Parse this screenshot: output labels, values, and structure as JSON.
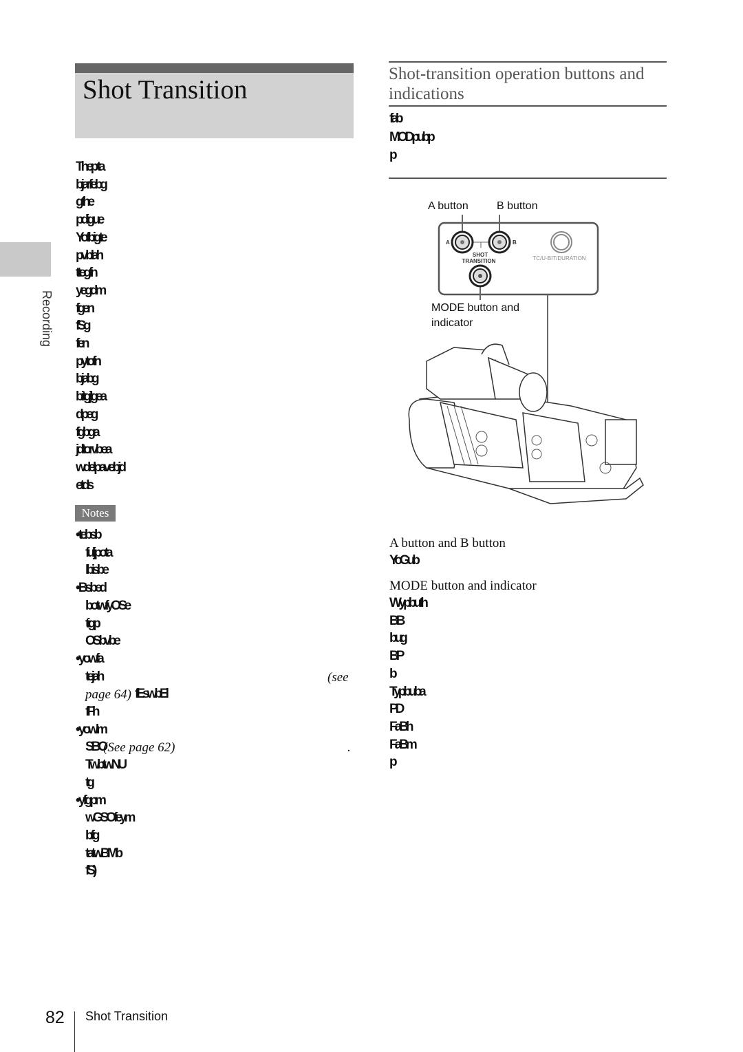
{
  "page": {
    "title": "Shot Transition",
    "section_tab": "Recording",
    "page_number": "82",
    "footer_title": "Shot Transition"
  },
  "left": {
    "intro_lines": [
      "Thep ta",
      "bjarfebg",
      "gthe",
      "pdigue",
      "Yofbigte",
      "pvblah",
      "ttegfn",
      "yegdm",
      "fgen",
      "fSg",
      "fen",
      "pytofn",
      "bjabg",
      "bitgjlgea",
      "dpeg",
      "fgbga",
      "jdtorvbea",
      "wdelpavebjd",
      "etds"
    ],
    "notes_label": "Notes",
    "notes_lines": [
      {
        "text": "• tebsb"
      },
      {
        "text": "fuljpota",
        "indent": true
      },
      {
        "text": "lbisbe",
        "indent": true
      },
      {
        "text": "• Bsbed"
      },
      {
        "text": "botwfyOSe",
        "indent": true
      },
      {
        "text": "tigp",
        "indent": true
      },
      {
        "text": "OSbvbe",
        "indent": true
      },
      {
        "text": "• yowfa"
      },
      {
        "text": "tejah",
        "indent": true,
        "right_italic": "(see"
      },
      {
        "text": "fEswbEl",
        "indent": true,
        "italic_prefix": "page 64)"
      },
      {
        "text": "fFh",
        "indent": true
      },
      {
        "text": "• yowlm"
      },
      {
        "text": "SBO",
        "indent": true,
        "italic_suffix": "(See page 62)",
        "right_text": "."
      },
      {
        "text": "TwbtwNU",
        "indent": true
      },
      {
        "text": "tg",
        "indent": true
      },
      {
        "text": "• yfgpm"
      },
      {
        "text": "wGSOfeym",
        "indent": true
      },
      {
        "text": "bfg",
        "indent": true
      },
      {
        "text": "tatwBMb",
        "indent": true
      },
      {
        "text": "fS)",
        "indent": true
      }
    ]
  },
  "right": {
    "heading_line1": "Shot-transition operation buttons and",
    "heading_line2": "indications",
    "intro_lines": [
      "fab",
      "MODpubp",
      "p"
    ],
    "diagram": {
      "label_a": "A button",
      "label_b": "B button",
      "label_mode_1": "MODE button and",
      "label_mode_2": "indicator",
      "panel_a": "A",
      "panel_b": "B",
      "panel_shot": "SHOT",
      "panel_transition": "TRANSITION",
      "panel_tc": "TC/U-BIT/DURATION"
    },
    "sub1_title": "A button and B button",
    "sub1_lines": [
      "YoGub"
    ],
    "sub2_title": "MODE button and indicator",
    "sub2_lines": [
      "Wypbuth",
      "BB",
      "bug",
      "BP",
      "b",
      "Typbuba",
      "PD",
      "FaBh",
      "FaBm",
      "p"
    ]
  }
}
